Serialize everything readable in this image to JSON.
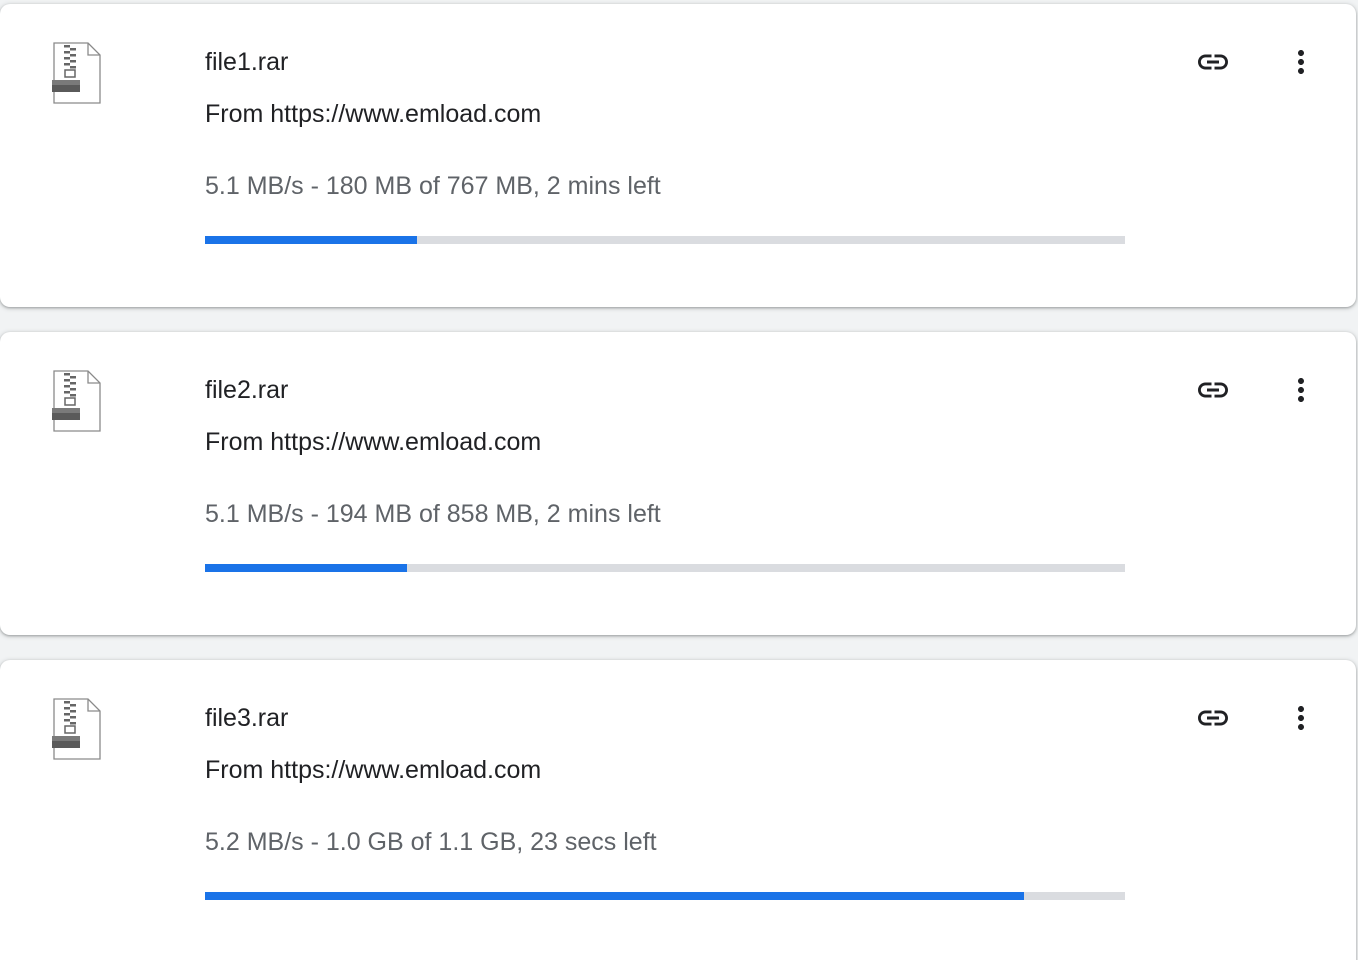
{
  "colors": {
    "progress_fill": "#1a73e8",
    "progress_track": "#dadce0",
    "primary_text": "#202124",
    "secondary_text": "#5f6368"
  },
  "downloads": [
    {
      "file_name": "file1.rar",
      "source": "From https://www.emload.com",
      "status": "5.1 MB/s - 180 MB of 767 MB, 2 mins left",
      "progress": 0.23,
      "icon": "zip-file-icon"
    },
    {
      "file_name": "file2.rar",
      "source": "From https://www.emload.com",
      "status": "5.1 MB/s - 194 MB of 858 MB, 2 mins left",
      "progress": 0.22,
      "icon": "zip-file-icon"
    },
    {
      "file_name": "file3.rar",
      "source": "From https://www.emload.com",
      "status": "5.2 MB/s - 1.0 GB of 1.1 GB, 23 secs left",
      "progress": 0.89,
      "icon": "zip-file-icon"
    }
  ]
}
